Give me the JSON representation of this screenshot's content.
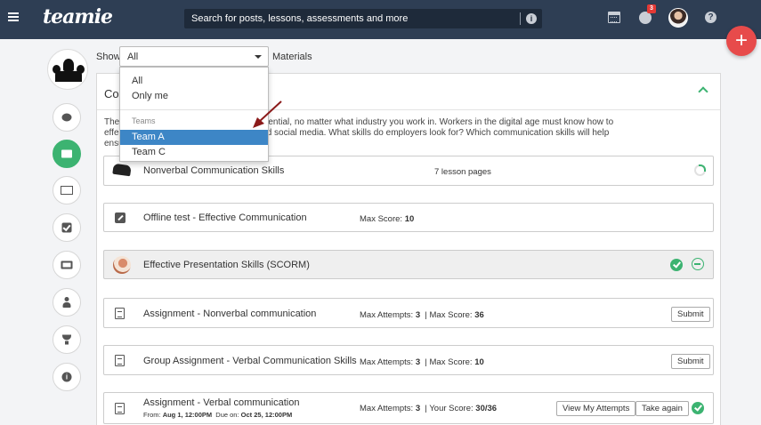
{
  "header": {
    "logo_text": "teamie",
    "search_placeholder": "Search for posts, lessons, assessments and more",
    "notification_count": "3"
  },
  "filter": {
    "show_label": "Show",
    "selected": "All",
    "suffix_label": "Materials"
  },
  "dropdown": {
    "options": [
      "All",
      "Only me"
    ],
    "group_label": "Teams",
    "team_options": [
      "Team A",
      "Team C"
    ],
    "highlighted": "Team A"
  },
  "panel": {
    "title_visible": "Con",
    "description_lines": [
      "The a                                                          periors, colleagues, and staff is essential, no matter what industry you work in. Workers in the digital age must know how to",
      "effec                                                          rson as well as via phone, email, and social media. What skills do employers look for? Which communication skills will help",
      "ensu"
    ]
  },
  "materials": [
    {
      "title": "Nonverbal Communication Skills",
      "meta": "7 lesson pages",
      "icon": "lesson-thumbnail-icon"
    },
    {
      "title": "Offline test - Effective Communication",
      "meta_label": "Max Score:",
      "meta_value": "10",
      "icon": "edit-icon"
    },
    {
      "title": "Effective Presentation Skills (SCORM)",
      "icon": "scorm-thumbnail-icon"
    },
    {
      "title": "Assignment - Nonverbal communication",
      "attempts_label": "Max Attempts:",
      "attempts_value": "3",
      "score_label": "Max Score:",
      "score_value": "36",
      "button": "Submit",
      "icon": "document-icon"
    },
    {
      "title": "Group Assignment - Verbal Communication Skills",
      "attempts_label": "Max Attempts:",
      "attempts_value": "3",
      "score_label": "Max Score:",
      "score_value": "10",
      "button": "Submit",
      "icon": "document-icon"
    },
    {
      "title": "Assignment - Verbal communication",
      "from_label": "From:",
      "from_value": "Aug 1, 12:00PM",
      "due_label": "Due on:",
      "due_value": "Oct 25, 12:00PM",
      "attempts_label": "Max Attempts:",
      "attempts_value": "3",
      "score_label": "Your Score:",
      "score_value": "30/36",
      "button_attempts": "View My Attempts",
      "button_retake": "Take again",
      "icon": "document-icon"
    }
  ],
  "colors": {
    "header_bg": "#2e3e54",
    "accent_green": "#3cb371",
    "fab_red": "#e74b4b",
    "selection_blue": "#3d86c6",
    "annotation_arrow": "#8b1a1a"
  }
}
